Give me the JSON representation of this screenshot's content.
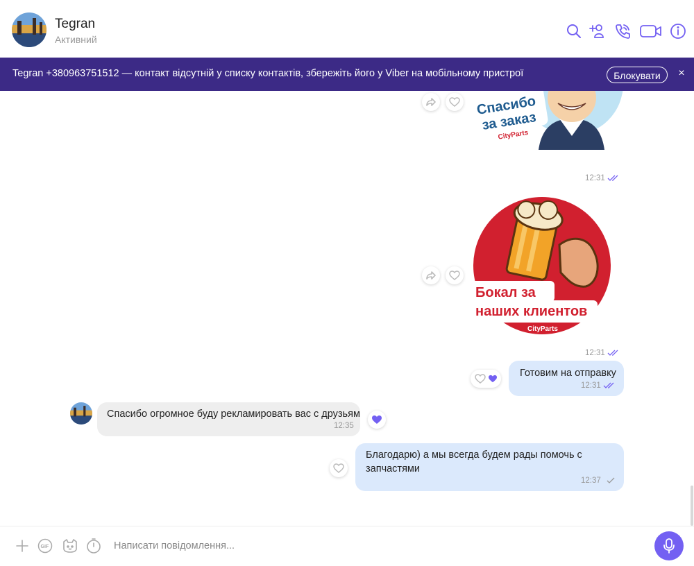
{
  "header": {
    "name": "Tegran",
    "status": "Активний"
  },
  "banner": {
    "text": "Tegran +380963751512 — контакт відсутній у списку контактів, збережіть його у Viber на мобільному пристрої",
    "block_label": "Блокувати",
    "close_glyph": "×"
  },
  "stickers": [
    {
      "line1": "Спасибо",
      "line2": "за заказ",
      "brand": "CityParts",
      "time": "12:31"
    },
    {
      "line1": "Бокал за",
      "line2": "наших клиентов",
      "brand": "CityParts",
      "time": "12:31"
    }
  ],
  "messages": [
    {
      "text": "Готовим на отправку",
      "time": "12:31"
    },
    {
      "text": "Спасибо огромное буду рекламировать вас с друзьям",
      "time": "12:35"
    },
    {
      "line1": "Благодарю) а мы всегда будем рады помочь с",
      "line2": "запчастями",
      "time": "12:37"
    }
  ],
  "composer": {
    "placeholder": "Написати повідомлення..."
  },
  "colors": {
    "accent": "#7360f2",
    "banner": "#3c2a86",
    "outgoing": "#dbe9fc",
    "incoming": "#eeeeee"
  }
}
